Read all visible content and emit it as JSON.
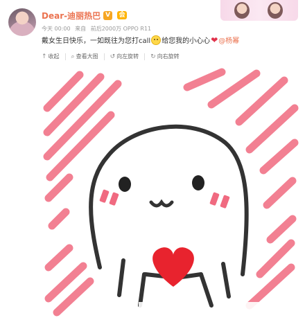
{
  "post": {
    "username": "Dear-迪丽热巴",
    "verified_label": "V",
    "vip_label": "会",
    "meta": {
      "time": "今天 00:00",
      "source_prefix": "来自",
      "source": "前后2000万 OPPO R11"
    },
    "text": {
      "prefix": "戴女生日快乐，一如既往为您打call",
      "middle": "给您我的小心心",
      "mention": "@杨幂"
    },
    "toolbar": {
      "collect": "收起",
      "view_large": "查看大图",
      "rotate_left": "向左旋转",
      "rotate_right": "向右旋转"
    }
  },
  "icons": [
    "avatar",
    "verified-icon",
    "vip-icon",
    "smile-emoji-icon",
    "heart-emoji-icon",
    "collapse-icon",
    "magnify-icon",
    "rotate-left-icon",
    "rotate-right-icon"
  ],
  "colors": {
    "username": "#eb7350",
    "stripes": "#f06a80",
    "heart": "#e8232e",
    "outline": "#333333"
  }
}
